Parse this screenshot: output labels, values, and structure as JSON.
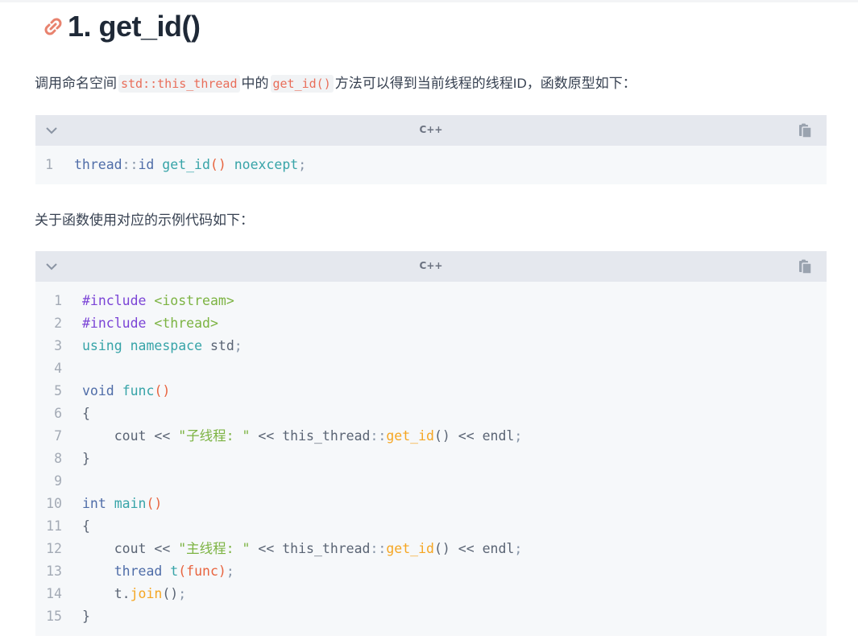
{
  "heading": {
    "text": "1. get_id()"
  },
  "paragraph1": {
    "before": "调用命名空间",
    "code1": "std::this_thread",
    "middle": "中的",
    "code2": "get_id()",
    "after": "方法可以得到当前线程的线程ID，函数原型如下："
  },
  "paragraph2": {
    "text": "关于函数使用对应的示例代码如下："
  },
  "block1": {
    "language": "C++",
    "lines": [
      {
        "num": "1",
        "tokens": [
          [
            "t-type",
            "thread"
          ],
          [
            "t-punct",
            "::"
          ],
          [
            "t-type",
            "id"
          ],
          [
            "t-plain",
            " "
          ],
          [
            "t-fn",
            "get_id"
          ],
          [
            "t-paren",
            "()"
          ],
          [
            "t-plain",
            " "
          ],
          [
            "t-kw",
            "noexcept"
          ],
          [
            "t-punct",
            ";"
          ]
        ]
      }
    ]
  },
  "block2": {
    "language": "C++",
    "lines": [
      {
        "num": "1",
        "tokens": [
          [
            "t-pre",
            "#include"
          ],
          [
            "t-plain",
            " "
          ],
          [
            "t-str",
            "<iostream>"
          ]
        ]
      },
      {
        "num": "2",
        "tokens": [
          [
            "t-pre",
            "#include"
          ],
          [
            "t-plain",
            " "
          ],
          [
            "t-str",
            "<thread>"
          ]
        ]
      },
      {
        "num": "3",
        "tokens": [
          [
            "t-kw",
            "using"
          ],
          [
            "t-plain",
            " "
          ],
          [
            "t-kw",
            "namespace"
          ],
          [
            "t-plain",
            " std"
          ],
          [
            "t-punct",
            ";"
          ]
        ]
      },
      {
        "num": "4",
        "tokens": []
      },
      {
        "num": "5",
        "tokens": [
          [
            "t-type",
            "void"
          ],
          [
            "t-plain",
            " "
          ],
          [
            "t-fn",
            "func"
          ],
          [
            "t-paren",
            "()"
          ]
        ]
      },
      {
        "num": "6",
        "tokens": [
          [
            "t-plain",
            "{"
          ]
        ]
      },
      {
        "num": "7",
        "tokens": [
          [
            "t-plain",
            "    cout "
          ],
          [
            "t-op",
            "<<"
          ],
          [
            "t-plain",
            " "
          ],
          [
            "t-str",
            "\"子线程: \""
          ],
          [
            "t-plain",
            " "
          ],
          [
            "t-op",
            "<<"
          ],
          [
            "t-plain",
            " this_thread"
          ],
          [
            "t-punct",
            "::"
          ],
          [
            "t-call",
            "get_id"
          ],
          [
            "t-plain",
            "() "
          ],
          [
            "t-op",
            "<<"
          ],
          [
            "t-plain",
            " endl"
          ],
          [
            "t-punct",
            ";"
          ]
        ]
      },
      {
        "num": "8",
        "tokens": [
          [
            "t-plain",
            "}"
          ]
        ]
      },
      {
        "num": "9",
        "tokens": []
      },
      {
        "num": "10",
        "tokens": [
          [
            "t-type",
            "int"
          ],
          [
            "t-plain",
            " "
          ],
          [
            "t-fn",
            "main"
          ],
          [
            "t-paren",
            "()"
          ]
        ]
      },
      {
        "num": "11",
        "tokens": [
          [
            "t-plain",
            "{"
          ]
        ]
      },
      {
        "num": "12",
        "tokens": [
          [
            "t-plain",
            "    cout "
          ],
          [
            "t-op",
            "<<"
          ],
          [
            "t-plain",
            " "
          ],
          [
            "t-str",
            "\"主线程: \""
          ],
          [
            "t-plain",
            " "
          ],
          [
            "t-op",
            "<<"
          ],
          [
            "t-plain",
            " this_thread"
          ],
          [
            "t-punct",
            "::"
          ],
          [
            "t-call",
            "get_id"
          ],
          [
            "t-plain",
            "() "
          ],
          [
            "t-op",
            "<<"
          ],
          [
            "t-plain",
            " endl"
          ],
          [
            "t-punct",
            ";"
          ]
        ]
      },
      {
        "num": "13",
        "tokens": [
          [
            "t-plain",
            "    "
          ],
          [
            "t-type",
            "thread"
          ],
          [
            "t-plain",
            " "
          ],
          [
            "t-fn",
            "t"
          ],
          [
            "t-paren",
            "("
          ],
          [
            "t-paren",
            "func"
          ],
          [
            "t-paren",
            ")"
          ],
          [
            "t-punct",
            ";"
          ]
        ]
      },
      {
        "num": "14",
        "tokens": [
          [
            "t-plain",
            "    t."
          ],
          [
            "t-call",
            "join"
          ],
          [
            "t-plain",
            "()"
          ],
          [
            "t-punct",
            ";"
          ]
        ]
      },
      {
        "num": "15",
        "tokens": [
          [
            "t-plain",
            "}"
          ]
        ]
      }
    ]
  },
  "icons": {
    "anchor": "link-icon",
    "collapse": "chevron-down-icon",
    "copy": "copy-icon",
    "anchor_color": "#e8826e"
  }
}
